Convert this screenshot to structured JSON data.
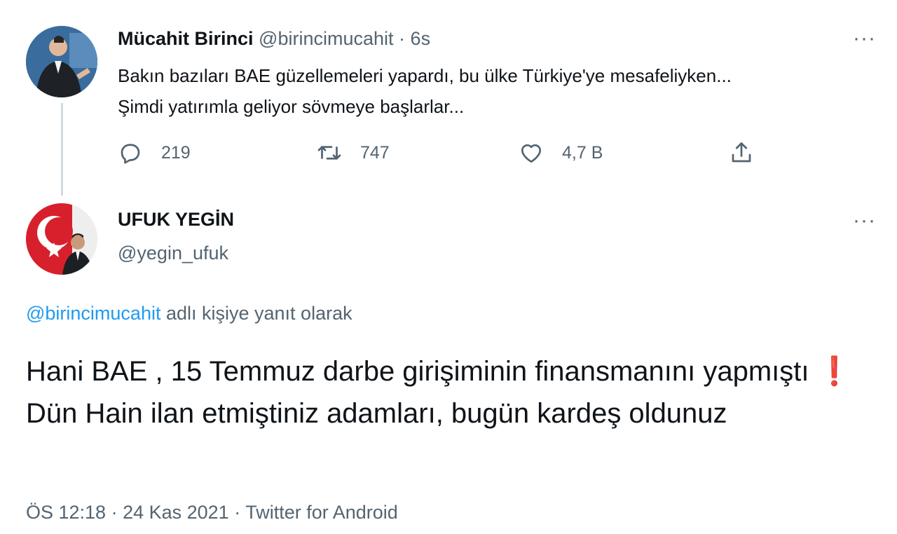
{
  "parent_tweet": {
    "name": "Mücahit Birinci",
    "handle": "@birincimucahit",
    "separator": "·",
    "time": "6s",
    "text_line1": "Bakın bazıları BAE güzellemeleri yapardı, bu ülke Türkiye'ye mesafeliyken...",
    "text_line2": "Şimdi yatırımla geliyor sövmeye başlarlar...",
    "reply_count": "219",
    "retweet_count": "747",
    "like_count": "4,7 B",
    "more_label": "···"
  },
  "main_tweet": {
    "name": "UFUK YEGİN",
    "handle": "@yegin_ufuk",
    "more_label": "···",
    "replying_mention": "@birincimucahit",
    "replying_suffix": " adlı kişiye yanıt olarak",
    "text_part1": "Hani BAE , 15 Temmuz darbe girişiminin finansmanını yapmıştı ",
    "text_emoji": "❗",
    "text_part2": " Dün Hain ilan etmiştiniz adamları,  bugün kardeş oldunuz",
    "meta": "ÖS 12:18 · 24 Kas 2021 · Twitter for Android"
  },
  "icons": {
    "reply": "reply-icon",
    "retweet": "retweet-icon",
    "like": "heart-icon",
    "share": "share-icon"
  },
  "colors": {
    "text": "#0f1419",
    "secondary": "#536471",
    "link": "#1d9bf0",
    "thread_line": "#cfd9de"
  }
}
